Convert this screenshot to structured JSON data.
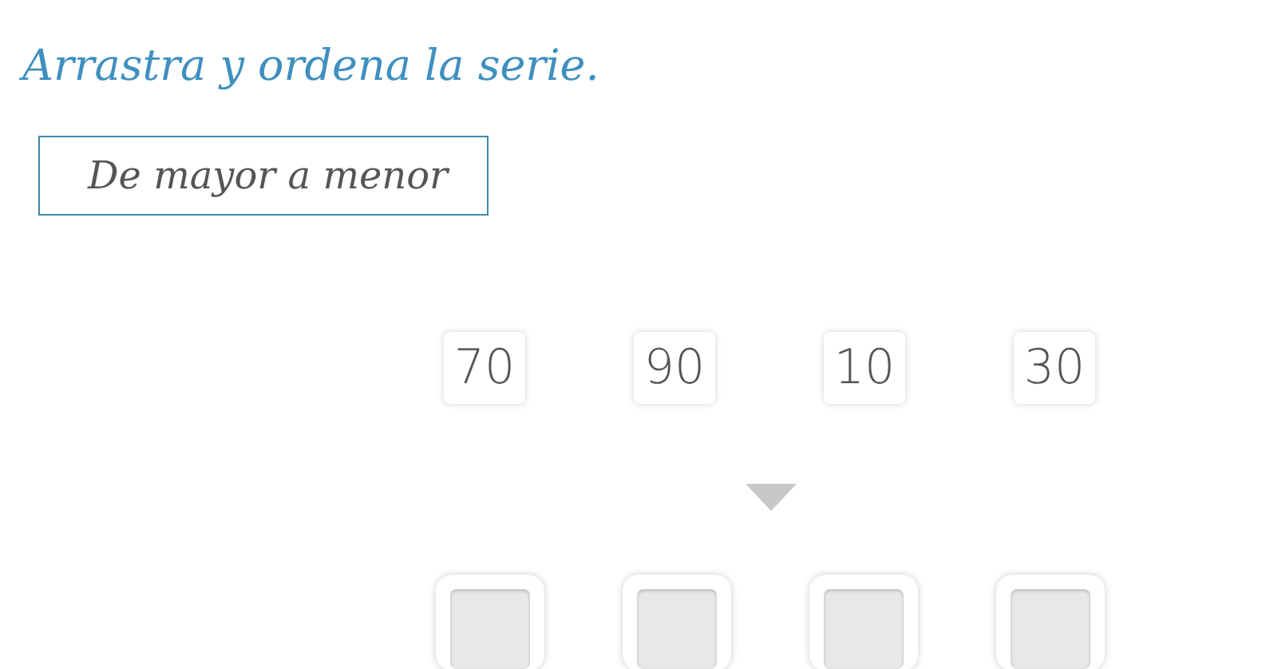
{
  "title": "Arrastra y ordena la serie.",
  "instruction": "De mayor a menor",
  "tiles": [
    {
      "label": "70"
    },
    {
      "label": "90"
    },
    {
      "label": "10"
    },
    {
      "label": "30"
    }
  ],
  "slots": [
    {
      "filled": false
    },
    {
      "filled": false
    },
    {
      "filled": false
    },
    {
      "filled": false
    }
  ]
}
